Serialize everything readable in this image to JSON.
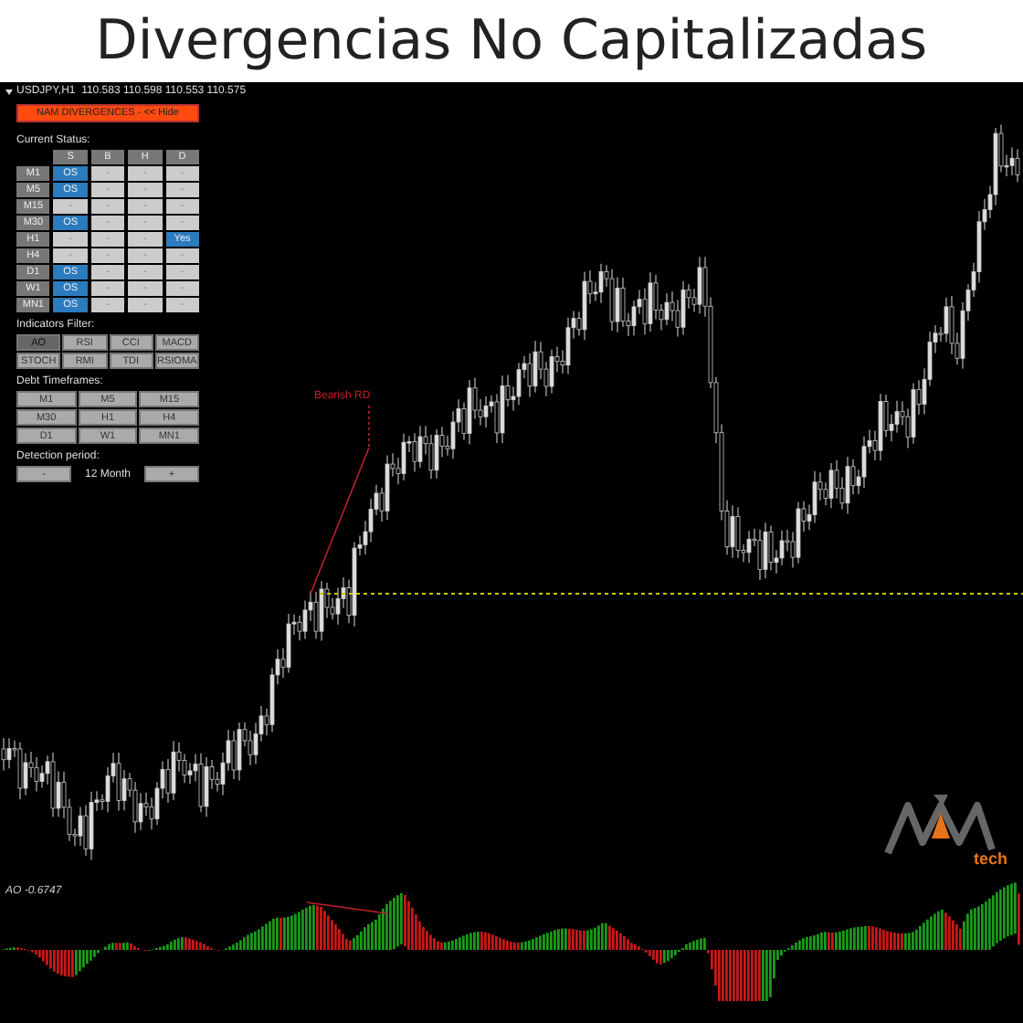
{
  "title": "Divergencias No Capitalizadas",
  "chart": {
    "symbol_line": "USDJPY,H1  110.583 110.598 110.553 110.575",
    "annotation": "Bearish RD",
    "indicator_label": "AO -0.6747",
    "logo_text": "tech"
  },
  "panel": {
    "hide_button": "NAM DIVERGENCES - << Hide",
    "status_title": "Current Status:",
    "status_columns": [
      "S",
      "B",
      "H",
      "D"
    ],
    "status_rows": [
      {
        "timeframe": "M1",
        "cells": [
          {
            "text": "OS",
            "active": true
          },
          {
            "text": "-",
            "active": false
          },
          {
            "text": "-",
            "active": false
          },
          {
            "text": "-",
            "active": false
          }
        ]
      },
      {
        "timeframe": "M5",
        "cells": [
          {
            "text": "OS",
            "active": true
          },
          {
            "text": "-",
            "active": false
          },
          {
            "text": "-",
            "active": false
          },
          {
            "text": "-",
            "active": false
          }
        ]
      },
      {
        "timeframe": "M15",
        "cells": [
          {
            "text": "-",
            "active": false
          },
          {
            "text": "-",
            "active": false
          },
          {
            "text": "-",
            "active": false
          },
          {
            "text": "-",
            "active": false
          }
        ]
      },
      {
        "timeframe": "M30",
        "cells": [
          {
            "text": "OS",
            "active": true
          },
          {
            "text": "-",
            "active": false
          },
          {
            "text": "-",
            "active": false
          },
          {
            "text": "-",
            "active": false
          }
        ]
      },
      {
        "timeframe": "H1",
        "cells": [
          {
            "text": "-",
            "active": false
          },
          {
            "text": "-",
            "active": false
          },
          {
            "text": "-",
            "active": false
          },
          {
            "text": "Yes",
            "active": true
          }
        ]
      },
      {
        "timeframe": "H4",
        "cells": [
          {
            "text": "-",
            "active": false
          },
          {
            "text": "-",
            "active": false
          },
          {
            "text": "-",
            "active": false
          },
          {
            "text": "-",
            "active": false
          }
        ]
      },
      {
        "timeframe": "D1",
        "cells": [
          {
            "text": "OS",
            "active": true
          },
          {
            "text": "-",
            "active": false
          },
          {
            "text": "-",
            "active": false
          },
          {
            "text": "-",
            "active": false
          }
        ]
      },
      {
        "timeframe": "W1",
        "cells": [
          {
            "text": "OS",
            "active": true
          },
          {
            "text": "-",
            "active": false
          },
          {
            "text": "-",
            "active": false
          },
          {
            "text": "-",
            "active": false
          }
        ]
      },
      {
        "timeframe": "MN1",
        "cells": [
          {
            "text": "OS",
            "active": true
          },
          {
            "text": "-",
            "active": false
          },
          {
            "text": "-",
            "active": false
          },
          {
            "text": "-",
            "active": false
          }
        ]
      }
    ],
    "filter_title": "Indicators Filter:",
    "filters": [
      {
        "label": "AO",
        "selected": true
      },
      {
        "label": "RSI",
        "selected": false
      },
      {
        "label": "CCI",
        "selected": false
      },
      {
        "label": "MACD",
        "selected": false
      },
      {
        "label": "STOCH",
        "selected": false
      },
      {
        "label": "RMI",
        "selected": false
      },
      {
        "label": "TDI",
        "selected": false
      },
      {
        "label": "RSIOMA",
        "selected": false
      }
    ],
    "timeframes_title": "Debt Timeframes:",
    "timeframes": [
      {
        "label": "M1",
        "selected": false
      },
      {
        "label": "M5",
        "selected": false
      },
      {
        "label": "M15",
        "selected": false
      },
      {
        "label": "M30",
        "selected": false
      },
      {
        "label": "H1",
        "selected": false
      },
      {
        "label": "H4",
        "selected": false
      },
      {
        "label": "D1",
        "selected": false
      },
      {
        "label": "W1",
        "selected": false
      },
      {
        "label": "MN1",
        "selected": false
      }
    ],
    "period_title": "Detection period:",
    "period_minus": "-",
    "period_value": "12 Month",
    "period_plus": "+"
  }
}
